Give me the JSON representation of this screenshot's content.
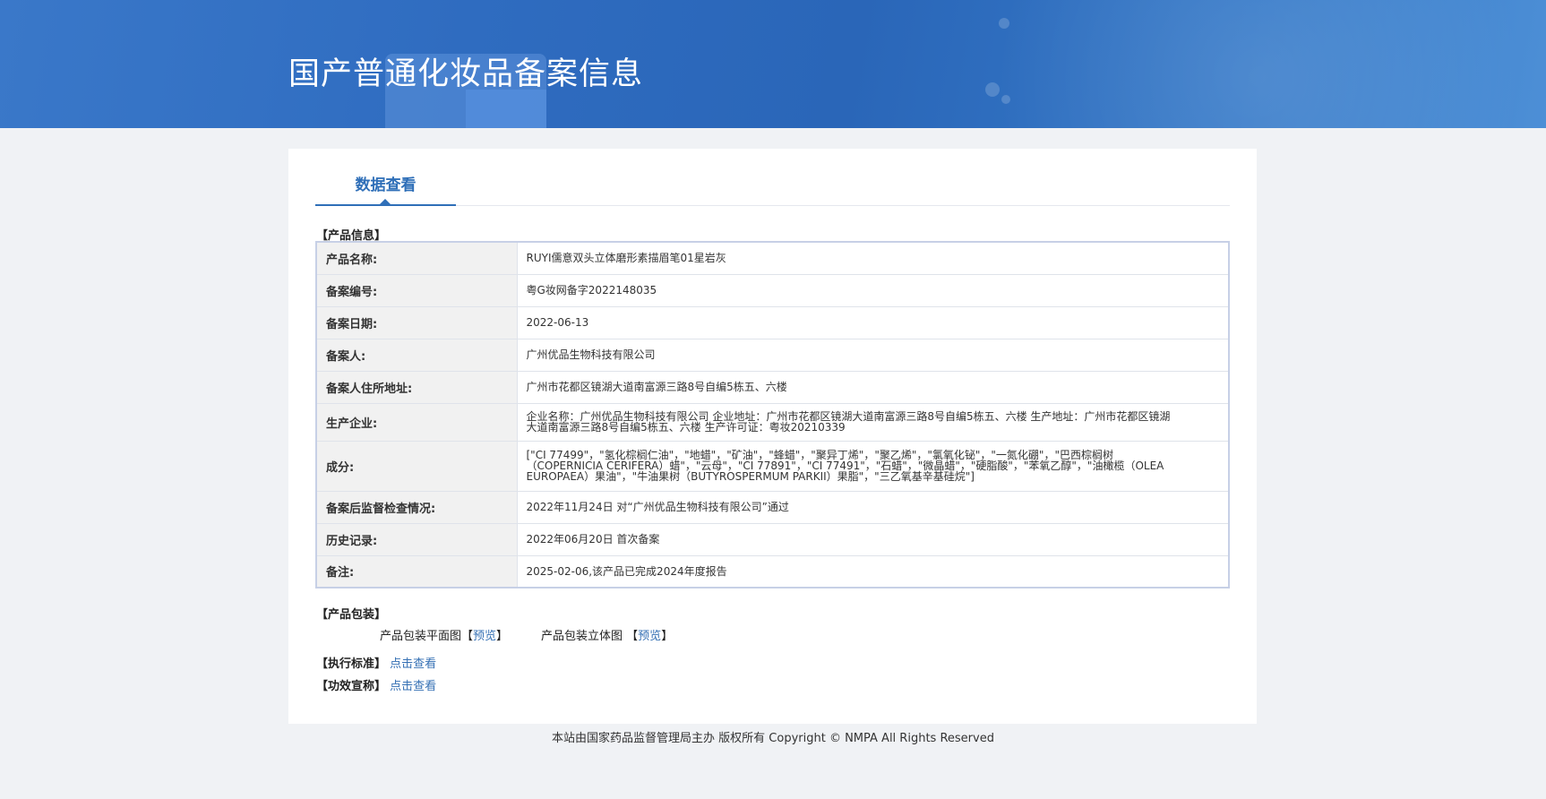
{
  "header": {
    "title": "国产普通化妆品备案信息"
  },
  "tabs": [
    {
      "label": "数据查看"
    }
  ],
  "product_info": {
    "section_title": "【产品信息】",
    "rows": [
      {
        "label": "产品名称:",
        "value": "RUYI儒意双头立体磨形素描眉笔01星岩灰"
      },
      {
        "label": "备案编号:",
        "value": "粤G妆网备字2022148035"
      },
      {
        "label": "备案日期:",
        "value": "2022-06-13"
      },
      {
        "label": "备案人:",
        "value": "广州优品生物科技有限公司"
      },
      {
        "label": "备案人住所地址:",
        "value": "广州市花都区镜湖大道南富源三路8号自编5栋五、六楼"
      },
      {
        "label": "生产企业:",
        "value": "企业名称：广州优品生物科技有限公司 企业地址：广州市花都区镜湖大道南富源三路8号自编5栋五、六楼 生产地址：广州市花都区镜湖大道南富源三路8号自编5栋五、六楼 生产许可证：粤妆20210339"
      },
      {
        "label": "成分:",
        "value": "[\"CI 77499\"，\"氢化棕榈仁油\"，\"地蜡\"，\"矿油\"，\"蜂蜡\"，\"聚异丁烯\"，\"聚乙烯\"，\"氯氧化铋\"，\"一氮化硼\"，\"巴西棕榈树（COPERNICIA CERIFERA）蜡\"，\"云母\"，\"CI 77891\"，\"CI 77491\"，\"石蜡\"，\"微晶蜡\"，\"硬脂酸\"，\"苯氧乙醇\"，\"油橄榄（OLEA EUROPAEA）果油\"，\"牛油果树（BUTYROSPERMUM PARKII）果脂\"，\"三乙氧基辛基硅烷\"]"
      },
      {
        "label": "备案后监督检查情况:",
        "value": "2022年11月24日 对“广州优品生物科技有限公司”通过"
      },
      {
        "label": "历史记录:",
        "value": "2022年06月20日 首次备案"
      },
      {
        "label": "备注:",
        "value": "2025-02-06,该产品已完成2024年度报告"
      }
    ]
  },
  "packaging": {
    "section_title": "【产品包装】",
    "flat_label": "产品包装平面图",
    "solid_label": "产品包装立体图",
    "preview": "预览",
    "bracket_open": "【",
    "bracket_close": "】"
  },
  "standard": {
    "label": "【执行标准】",
    "link": "点击查看"
  },
  "efficacy": {
    "label": "【功效宣称】",
    "link": "点击查看"
  },
  "footer": {
    "text": "本站由国家药品监督管理局主办 版权所有 Copyright © NMPA All Rights Reserved"
  }
}
